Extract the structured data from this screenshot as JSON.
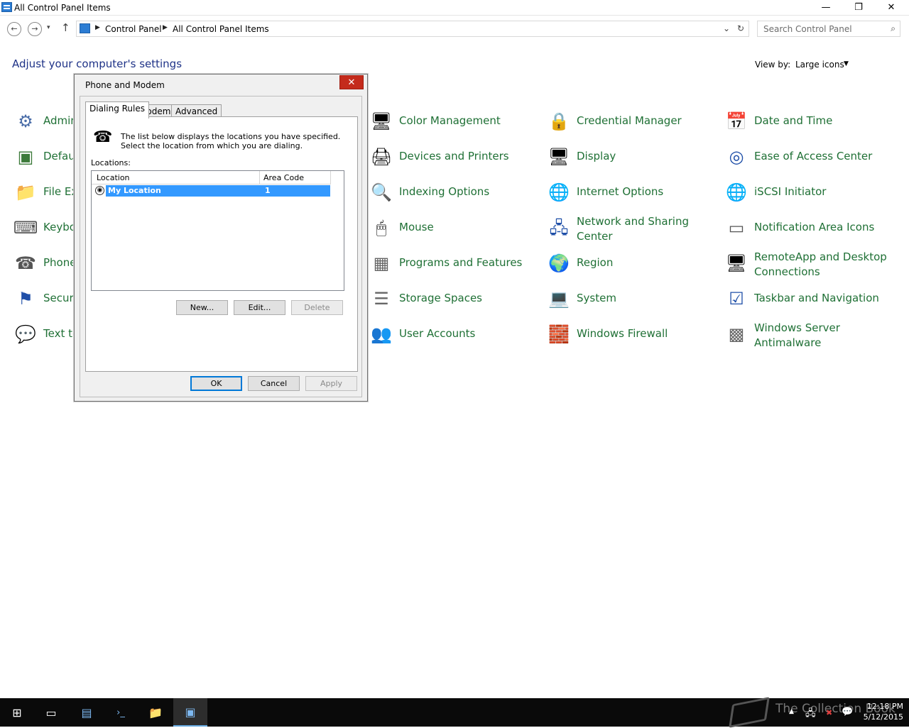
{
  "window": {
    "title": "All Control Panel Items",
    "minimize": "—",
    "restore": "❐",
    "close": "✕"
  },
  "nav": {
    "back": "←",
    "forward": "→",
    "recent": "▾",
    "up": "↑",
    "breadcrumb": [
      "Control Panel",
      "All Control Panel Items"
    ],
    "dropdown": "⌄",
    "refresh": "↻",
    "search_placeholder": "Search Control Panel",
    "search_icon": "⌕"
  },
  "header": {
    "title": "Adjust your computer's settings",
    "view_by_label": "View by:",
    "view_by_value": "Large icons",
    "view_by_arrow": "▼"
  },
  "items": [
    {
      "label": "Admin",
      "icon": "⚙",
      "name": "administrative-tools"
    },
    {
      "label": "Defau",
      "icon": "▣",
      "name": "default-programs"
    },
    {
      "label": "File Ex",
      "icon": "📁",
      "name": "file-explorer-options"
    },
    {
      "label": "Keybo",
      "icon": "⌨",
      "name": "keyboard"
    },
    {
      "label": "Phone",
      "icon": "☎",
      "name": "phone-and-modem"
    },
    {
      "label": "Securi",
      "icon": "⚑",
      "name": "security-and-maintenance"
    },
    {
      "label": "Text to",
      "icon": "💬",
      "name": "text-to-speech"
    },
    {
      "label": "Color Management",
      "icon": "🖥",
      "name": "color-management"
    },
    {
      "label": "Devices and Printers",
      "icon": "🖨",
      "name": "devices-and-printers"
    },
    {
      "label": "Indexing Options",
      "icon": "🔍",
      "name": "indexing-options"
    },
    {
      "label": "Mouse",
      "icon": "🖱",
      "name": "mouse"
    },
    {
      "label": "Programs and Features",
      "icon": "▦",
      "name": "programs-and-features"
    },
    {
      "label": "Storage Spaces",
      "icon": "☰",
      "name": "storage-spaces"
    },
    {
      "label": "User Accounts",
      "icon": "👥",
      "name": "user-accounts"
    },
    {
      "label": "Credential Manager",
      "icon": "🔒",
      "name": "credential-manager"
    },
    {
      "label": "Display",
      "icon": "🖥",
      "name": "display"
    },
    {
      "label": "Internet Options",
      "icon": "🌐",
      "name": "internet-options"
    },
    {
      "label": "Network and Sharing Center",
      "icon": "🖧",
      "name": "network-and-sharing-center"
    },
    {
      "label": "Region",
      "icon": "🌍",
      "name": "region"
    },
    {
      "label": "System",
      "icon": "💻",
      "name": "system"
    },
    {
      "label": "Windows Firewall",
      "icon": "🧱",
      "name": "windows-firewall"
    },
    {
      "label": "Date and Time",
      "icon": "📅",
      "name": "date-and-time"
    },
    {
      "label": "Ease of Access Center",
      "icon": "◎",
      "name": "ease-of-access-center"
    },
    {
      "label": "iSCSI Initiator",
      "icon": "🌐",
      "name": "iscsi-initiator"
    },
    {
      "label": "Notification Area Icons",
      "icon": "▭",
      "name": "notification-area-icons"
    },
    {
      "label": "RemoteApp and Desktop Connections",
      "icon": "🖥",
      "name": "remoteapp-and-desktop-connections"
    },
    {
      "label": "Taskbar and Navigation",
      "icon": "☑",
      "name": "taskbar-and-navigation"
    },
    {
      "label": "Windows Server Antimalware",
      "icon": "▩",
      "name": "windows-server-antimalware"
    }
  ],
  "dialog": {
    "title": "Phone and Modem",
    "close": "✕",
    "tabs": [
      "Dialing Rules",
      "Modems",
      "Advanced"
    ],
    "description": "The list below displays the locations you have specified. Select the location from which you are dialing.",
    "locations_label": "Locations:",
    "columns": [
      "Location",
      "Area Code"
    ],
    "rows": [
      {
        "location": "My Location",
        "area_code": "1"
      }
    ],
    "phone_icon": "☎",
    "row_icon": "◉",
    "buttons": {
      "new": "New...",
      "edit": "Edit...",
      "delete": "Delete"
    },
    "footer": {
      "ok": "OK",
      "cancel": "Cancel",
      "apply": "Apply"
    }
  },
  "taskbar": {
    "start": "⊞",
    "task_view": "▭",
    "server_manager": "▤",
    "powershell": "›_",
    "explorer": "📁",
    "control_panel": "▣",
    "tray_up": "▲",
    "tray_network": "🖧",
    "tray_volume": "✖",
    "tray_notifications": "💬",
    "time": "12:18 PM",
    "date": "5/12/2015",
    "watermark": "The Collection Book"
  }
}
